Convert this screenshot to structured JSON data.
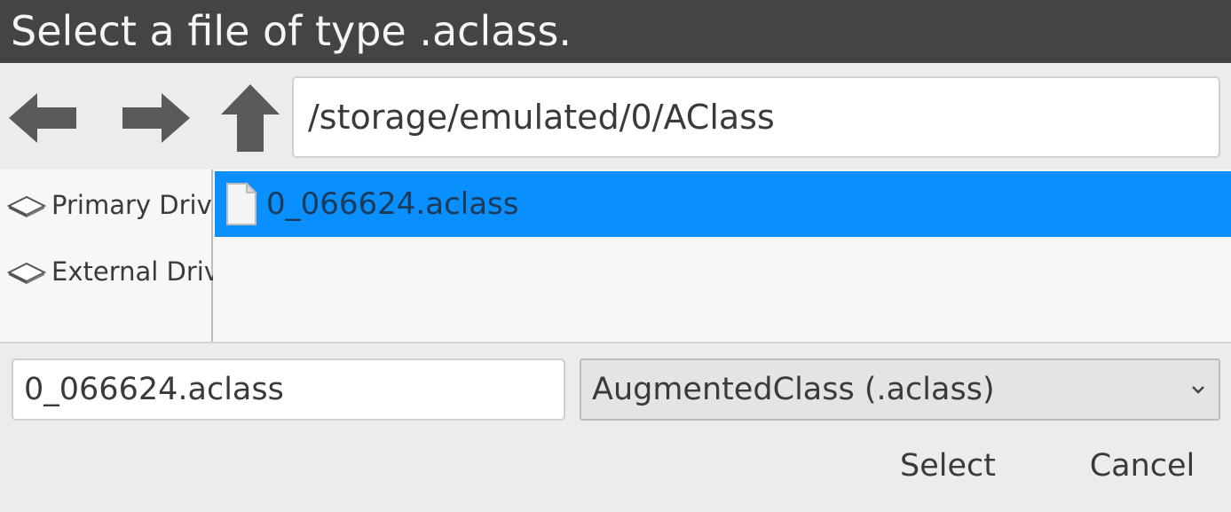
{
  "dialog": {
    "title": "Select a file of type .aclass."
  },
  "toolbar": {
    "back_icon": "arrow-left-icon",
    "forward_icon": "arrow-right-icon",
    "up_icon": "arrow-up-icon",
    "path": "/storage/emulated/0/AClass"
  },
  "sidebar": {
    "items": [
      {
        "label": "Primary Drive",
        "icon": "drive-icon"
      },
      {
        "label": "External Drive",
        "icon": "drive-icon"
      }
    ]
  },
  "files": {
    "items": [
      {
        "name": "0_066624.aclass",
        "icon": "file-icon",
        "selected": true
      }
    ]
  },
  "footer": {
    "filename": "0_066624.aclass",
    "file_type": "AugmentedClass (.aclass)",
    "select_label": "Select",
    "cancel_label": "Cancel"
  },
  "colors": {
    "titlebar": "#444444",
    "selection": "#0a8fff",
    "icon_gray": "#5a5a5a"
  }
}
